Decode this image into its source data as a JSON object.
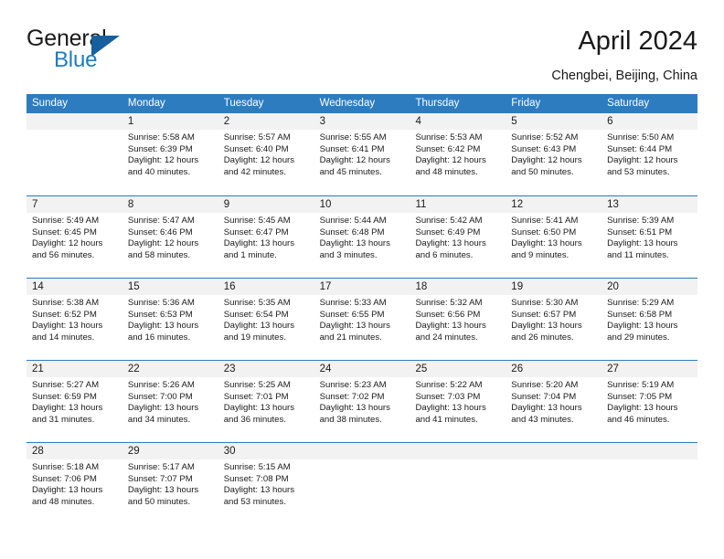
{
  "brand": {
    "word_one": "General",
    "word_two": "Blue",
    "triangle_icon": "triangle-logo-icon",
    "accent_color": "#1f7bc1",
    "triangle_color": "#16609e"
  },
  "header": {
    "title": "April 2024",
    "location": "Chengbei, Beijing, China"
  },
  "theme": {
    "header_blue": "#2d7cc0",
    "day_band_gray": "#f2f2f2",
    "text_color": "#1a1a1a"
  },
  "weekdays": [
    "Sunday",
    "Monday",
    "Tuesday",
    "Wednesday",
    "Thursday",
    "Friday",
    "Saturday"
  ],
  "weeks": [
    [
      {
        "day": "",
        "sunrise": "",
        "sunset": "",
        "daylight_line1": "",
        "daylight_line2": "",
        "empty": true
      },
      {
        "day": "1",
        "sunrise": "Sunrise: 5:58 AM",
        "sunset": "Sunset: 6:39 PM",
        "daylight_line1": "Daylight: 12 hours",
        "daylight_line2": "and 40 minutes."
      },
      {
        "day": "2",
        "sunrise": "Sunrise: 5:57 AM",
        "sunset": "Sunset: 6:40 PM",
        "daylight_line1": "Daylight: 12 hours",
        "daylight_line2": "and 42 minutes."
      },
      {
        "day": "3",
        "sunrise": "Sunrise: 5:55 AM",
        "sunset": "Sunset: 6:41 PM",
        "daylight_line1": "Daylight: 12 hours",
        "daylight_line2": "and 45 minutes."
      },
      {
        "day": "4",
        "sunrise": "Sunrise: 5:53 AM",
        "sunset": "Sunset: 6:42 PM",
        "daylight_line1": "Daylight: 12 hours",
        "daylight_line2": "and 48 minutes."
      },
      {
        "day": "5",
        "sunrise": "Sunrise: 5:52 AM",
        "sunset": "Sunset: 6:43 PM",
        "daylight_line1": "Daylight: 12 hours",
        "daylight_line2": "and 50 minutes."
      },
      {
        "day": "6",
        "sunrise": "Sunrise: 5:50 AM",
        "sunset": "Sunset: 6:44 PM",
        "daylight_line1": "Daylight: 12 hours",
        "daylight_line2": "and 53 minutes."
      }
    ],
    [
      {
        "day": "7",
        "sunrise": "Sunrise: 5:49 AM",
        "sunset": "Sunset: 6:45 PM",
        "daylight_line1": "Daylight: 12 hours",
        "daylight_line2": "and 56 minutes."
      },
      {
        "day": "8",
        "sunrise": "Sunrise: 5:47 AM",
        "sunset": "Sunset: 6:46 PM",
        "daylight_line1": "Daylight: 12 hours",
        "daylight_line2": "and 58 minutes."
      },
      {
        "day": "9",
        "sunrise": "Sunrise: 5:45 AM",
        "sunset": "Sunset: 6:47 PM",
        "daylight_line1": "Daylight: 13 hours",
        "daylight_line2": "and 1 minute."
      },
      {
        "day": "10",
        "sunrise": "Sunrise: 5:44 AM",
        "sunset": "Sunset: 6:48 PM",
        "daylight_line1": "Daylight: 13 hours",
        "daylight_line2": "and 3 minutes."
      },
      {
        "day": "11",
        "sunrise": "Sunrise: 5:42 AM",
        "sunset": "Sunset: 6:49 PM",
        "daylight_line1": "Daylight: 13 hours",
        "daylight_line2": "and 6 minutes."
      },
      {
        "day": "12",
        "sunrise": "Sunrise: 5:41 AM",
        "sunset": "Sunset: 6:50 PM",
        "daylight_line1": "Daylight: 13 hours",
        "daylight_line2": "and 9 minutes."
      },
      {
        "day": "13",
        "sunrise": "Sunrise: 5:39 AM",
        "sunset": "Sunset: 6:51 PM",
        "daylight_line1": "Daylight: 13 hours",
        "daylight_line2": "and 11 minutes."
      }
    ],
    [
      {
        "day": "14",
        "sunrise": "Sunrise: 5:38 AM",
        "sunset": "Sunset: 6:52 PM",
        "daylight_line1": "Daylight: 13 hours",
        "daylight_line2": "and 14 minutes."
      },
      {
        "day": "15",
        "sunrise": "Sunrise: 5:36 AM",
        "sunset": "Sunset: 6:53 PM",
        "daylight_line1": "Daylight: 13 hours",
        "daylight_line2": "and 16 minutes."
      },
      {
        "day": "16",
        "sunrise": "Sunrise: 5:35 AM",
        "sunset": "Sunset: 6:54 PM",
        "daylight_line1": "Daylight: 13 hours",
        "daylight_line2": "and 19 minutes."
      },
      {
        "day": "17",
        "sunrise": "Sunrise: 5:33 AM",
        "sunset": "Sunset: 6:55 PM",
        "daylight_line1": "Daylight: 13 hours",
        "daylight_line2": "and 21 minutes."
      },
      {
        "day": "18",
        "sunrise": "Sunrise: 5:32 AM",
        "sunset": "Sunset: 6:56 PM",
        "daylight_line1": "Daylight: 13 hours",
        "daylight_line2": "and 24 minutes."
      },
      {
        "day": "19",
        "sunrise": "Sunrise: 5:30 AM",
        "sunset": "Sunset: 6:57 PM",
        "daylight_line1": "Daylight: 13 hours",
        "daylight_line2": "and 26 minutes."
      },
      {
        "day": "20",
        "sunrise": "Sunrise: 5:29 AM",
        "sunset": "Sunset: 6:58 PM",
        "daylight_line1": "Daylight: 13 hours",
        "daylight_line2": "and 29 minutes."
      }
    ],
    [
      {
        "day": "21",
        "sunrise": "Sunrise: 5:27 AM",
        "sunset": "Sunset: 6:59 PM",
        "daylight_line1": "Daylight: 13 hours",
        "daylight_line2": "and 31 minutes."
      },
      {
        "day": "22",
        "sunrise": "Sunrise: 5:26 AM",
        "sunset": "Sunset: 7:00 PM",
        "daylight_line1": "Daylight: 13 hours",
        "daylight_line2": "and 34 minutes."
      },
      {
        "day": "23",
        "sunrise": "Sunrise: 5:25 AM",
        "sunset": "Sunset: 7:01 PM",
        "daylight_line1": "Daylight: 13 hours",
        "daylight_line2": "and 36 minutes."
      },
      {
        "day": "24",
        "sunrise": "Sunrise: 5:23 AM",
        "sunset": "Sunset: 7:02 PM",
        "daylight_line1": "Daylight: 13 hours",
        "daylight_line2": "and 38 minutes."
      },
      {
        "day": "25",
        "sunrise": "Sunrise: 5:22 AM",
        "sunset": "Sunset: 7:03 PM",
        "daylight_line1": "Daylight: 13 hours",
        "daylight_line2": "and 41 minutes."
      },
      {
        "day": "26",
        "sunrise": "Sunrise: 5:20 AM",
        "sunset": "Sunset: 7:04 PM",
        "daylight_line1": "Daylight: 13 hours",
        "daylight_line2": "and 43 minutes."
      },
      {
        "day": "27",
        "sunrise": "Sunrise: 5:19 AM",
        "sunset": "Sunset: 7:05 PM",
        "daylight_line1": "Daylight: 13 hours",
        "daylight_line2": "and 46 minutes."
      }
    ],
    [
      {
        "day": "28",
        "sunrise": "Sunrise: 5:18 AM",
        "sunset": "Sunset: 7:06 PM",
        "daylight_line1": "Daylight: 13 hours",
        "daylight_line2": "and 48 minutes."
      },
      {
        "day": "29",
        "sunrise": "Sunrise: 5:17 AM",
        "sunset": "Sunset: 7:07 PM",
        "daylight_line1": "Daylight: 13 hours",
        "daylight_line2": "and 50 minutes."
      },
      {
        "day": "30",
        "sunrise": "Sunrise: 5:15 AM",
        "sunset": "Sunset: 7:08 PM",
        "daylight_line1": "Daylight: 13 hours",
        "daylight_line2": "and 53 minutes."
      },
      {
        "day": "",
        "sunrise": "",
        "sunset": "",
        "daylight_line1": "",
        "daylight_line2": "",
        "empty": true
      },
      {
        "day": "",
        "sunrise": "",
        "sunset": "",
        "daylight_line1": "",
        "daylight_line2": "",
        "empty": true
      },
      {
        "day": "",
        "sunrise": "",
        "sunset": "",
        "daylight_line1": "",
        "daylight_line2": "",
        "empty": true
      },
      {
        "day": "",
        "sunrise": "",
        "sunset": "",
        "daylight_line1": "",
        "daylight_line2": "",
        "empty": true
      }
    ]
  ]
}
